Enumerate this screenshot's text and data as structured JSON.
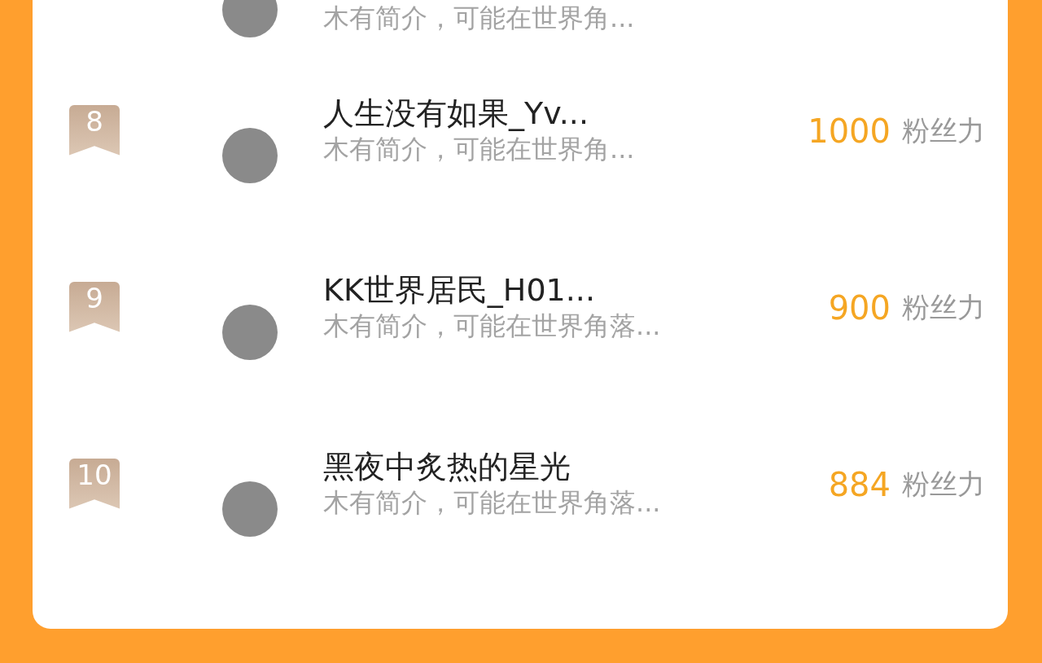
{
  "rows": [
    {
      "bio": "木有简介，可能在世界角..."
    },
    {
      "rank": "8",
      "name": "人生没有如果_Yv...",
      "bio": "木有简介，可能在世界角...",
      "score": "1000",
      "unit": "粉丝力"
    },
    {
      "rank": "9",
      "name": "KK世界居民_H01...",
      "bio": "木有简介，可能在世界角落...",
      "score": "900",
      "unit": "粉丝力"
    },
    {
      "rank": "10",
      "name": "黑夜中炙热的星光",
      "bio": "木有简介，可能在世界角落...",
      "score": "884",
      "unit": "粉丝力"
    }
  ]
}
